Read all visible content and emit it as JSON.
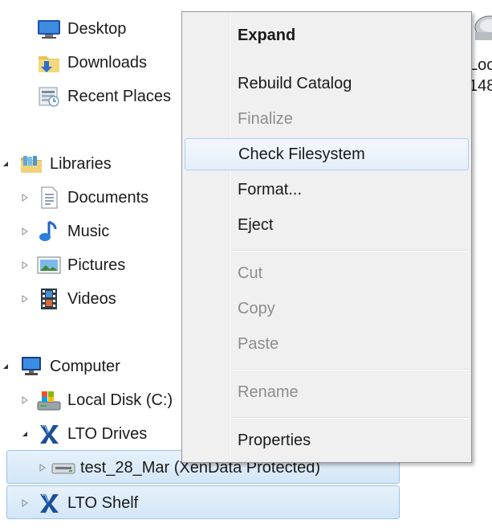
{
  "nav_tree": {
    "favorites": [
      {
        "label": "Desktop",
        "icon": "desktop-icon"
      },
      {
        "label": "Downloads",
        "icon": "downloads-folder-icon"
      },
      {
        "label": "Recent Places",
        "icon": "recent-places-icon"
      }
    ],
    "libraries": {
      "label": "Libraries",
      "items": [
        {
          "label": "Documents",
          "icon": "documents-icon"
        },
        {
          "label": "Music",
          "icon": "music-icon"
        },
        {
          "label": "Pictures",
          "icon": "pictures-icon"
        },
        {
          "label": "Videos",
          "icon": "videos-icon"
        }
      ]
    },
    "computer": {
      "label": "Computer",
      "items": [
        {
          "label": "Local Disk (C:)",
          "icon": "local-disk-icon"
        },
        {
          "label": "LTO Drives",
          "icon": "lto-drives-icon"
        }
      ],
      "drive": {
        "label": "test_28_Mar (XenData Protected)",
        "icon": "tape-drive-icon"
      },
      "shelf": {
        "label": "LTO Shelf",
        "icon": "lto-shelf-icon"
      }
    }
  },
  "right_pane": {
    "line1": "Loc",
    "line2": "148"
  },
  "context_menu": {
    "items": [
      {
        "label": "Expand",
        "enabled": true,
        "bold": true
      },
      {
        "label": "Rebuild Catalog",
        "enabled": true
      },
      {
        "label": "Finalize",
        "enabled": false
      },
      {
        "label": "Check Filesystem",
        "enabled": true,
        "hovered": true
      },
      {
        "label": "Format...",
        "enabled": true
      },
      {
        "label": "Eject",
        "enabled": true
      },
      {
        "label": "Cut",
        "enabled": false
      },
      {
        "label": "Copy",
        "enabled": false
      },
      {
        "label": "Paste",
        "enabled": false
      },
      {
        "label": "Rename",
        "enabled": false
      },
      {
        "label": "Properties",
        "enabled": true
      }
    ]
  },
  "colors": {
    "selection": "#d3e6f7",
    "menu_background": "#f0f0f0",
    "disabled_text": "#8d8d8d",
    "hover_border": "#aecff7"
  }
}
